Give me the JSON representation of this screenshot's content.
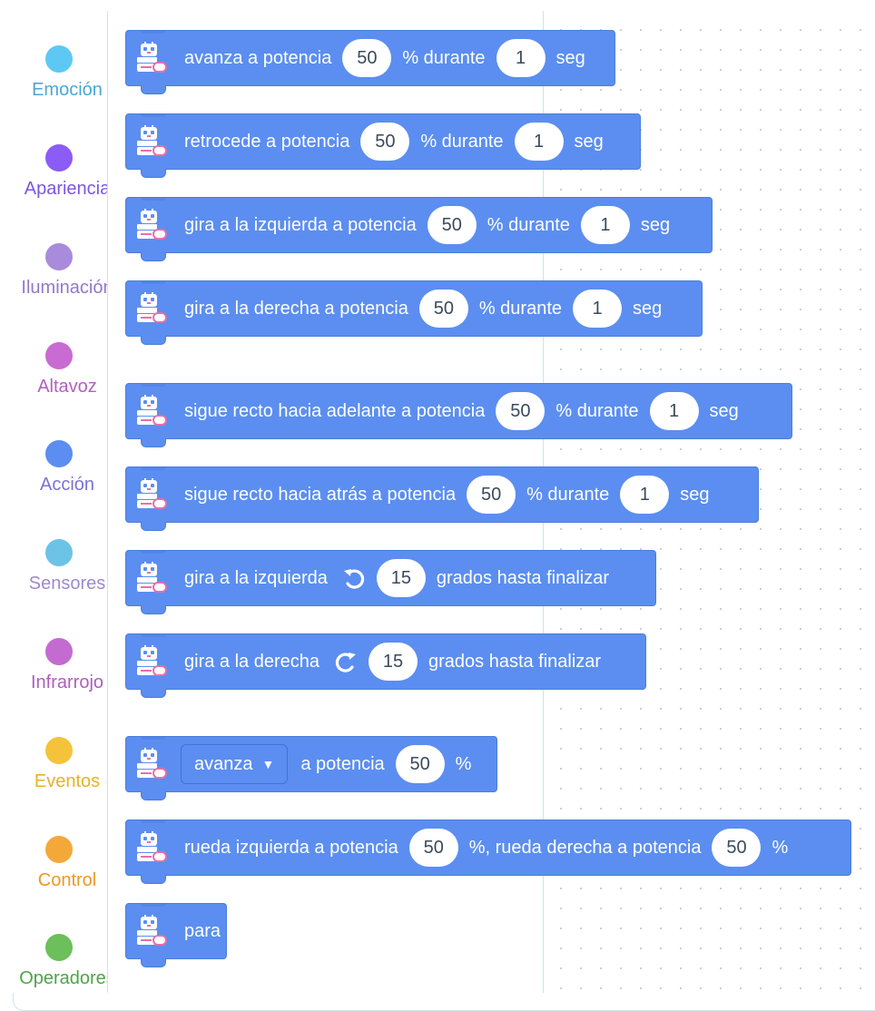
{
  "categories": [
    {
      "label": "Emoción",
      "color": "#5ec8f5",
      "label_color": "#4aa7d6"
    },
    {
      "label": "Apariencia",
      "color": "#8b5cf6",
      "label_color": "#7a55e5"
    },
    {
      "label": "Iluminación",
      "color": "#a98bdc",
      "label_color": "#9378c9"
    },
    {
      "label": "Altavoz",
      "color": "#c86bd2",
      "label_color": "#b55ec3"
    },
    {
      "label": "Acción",
      "color": "#5b8ef0",
      "label_color": "#7a72d6"
    },
    {
      "label": "Sensores",
      "color": "#6cc3e6",
      "label_color": "#9e8acd"
    },
    {
      "label": "Infrarrojo",
      "color": "#c46bd1",
      "label_color": "#ad5ec0"
    },
    {
      "label": "Eventos",
      "color": "#f5c33b",
      "label_color": "#e6b324"
    },
    {
      "label": "Control",
      "color": "#f5a83a",
      "label_color": "#ea9a24"
    },
    {
      "label": "Operadores",
      "color": "#6cbf5b",
      "label_color": "#4da546"
    }
  ],
  "blocks": {
    "forward": {
      "t1": "avanza a potencia",
      "power": "50",
      "t2": "% durante",
      "time": "1",
      "t3": "seg"
    },
    "backward": {
      "t1": "retrocede a potencia",
      "power": "50",
      "t2": "% durante",
      "time": "1",
      "t3": "seg"
    },
    "turn_left": {
      "t1": "gira a la izquierda a potencia",
      "power": "50",
      "t2": "% durante",
      "time": "1",
      "t3": "seg"
    },
    "turn_right": {
      "t1": "gira a la derecha a potencia",
      "power": "50",
      "t2": "% durante",
      "time": "1",
      "t3": "seg"
    },
    "straight_forward": {
      "t1": "sigue recto hacia adelante a potencia",
      "power": "50",
      "t2": "% durante",
      "time": "1",
      "t3": "seg"
    },
    "straight_backward": {
      "t1": "sigue recto hacia atrás a potencia",
      "power": "50",
      "t2": "% durante",
      "time": "1",
      "t3": "seg"
    },
    "turn_left_deg": {
      "t1": "gira a la izquierda",
      "degrees": "15",
      "t2": "grados hasta finalizar"
    },
    "turn_right_deg": {
      "t1": "gira a la derecha",
      "degrees": "15",
      "t2": "grados hasta finalizar"
    },
    "move_dir": {
      "direction": "avanza",
      "t1": "a potencia",
      "power": "50",
      "t2": "%"
    },
    "wheels": {
      "t1": "rueda izquierda a potencia",
      "left_power": "50",
      "t2": "%, rueda derecha a potencia",
      "right_power": "50",
      "t3": "%"
    },
    "stop": {
      "t1": "para"
    }
  }
}
